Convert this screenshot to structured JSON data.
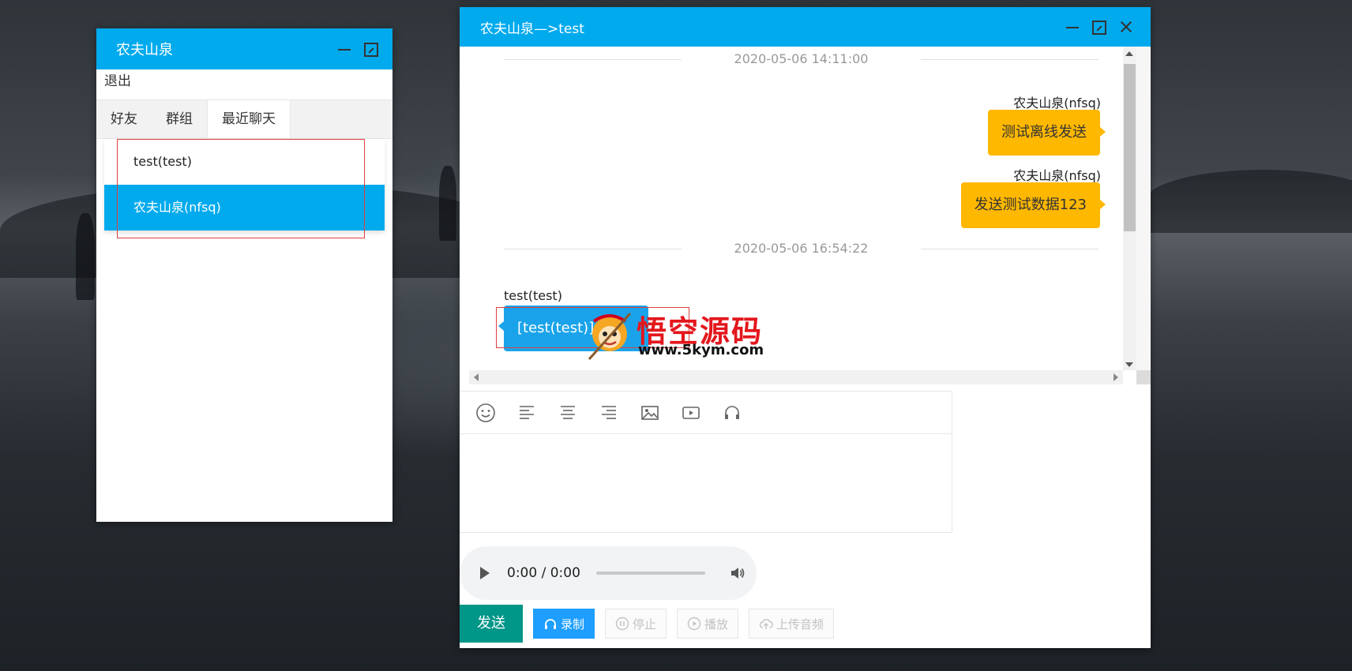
{
  "left_window": {
    "title": "农夫山泉",
    "logout": "退出",
    "tabs": [
      "好友",
      "群组",
      "最近聊天"
    ],
    "active_tab": "最近聊天",
    "contacts": [
      {
        "label": "test(test)"
      },
      {
        "label": "农夫山泉(nfsq)"
      }
    ],
    "active_contact": "农夫山泉(nfsq)"
  },
  "chat_window": {
    "title": "农夫山泉—>test",
    "timestamps": [
      "2020-05-06 14:11:00",
      "2020-05-06 16:54:22"
    ],
    "messages": [
      {
        "sender": "农夫山泉(nfsq)",
        "text": "测试离线发送",
        "side": "right"
      },
      {
        "sender": "农夫山泉(nfsq)",
        "text": "发送测试数据123",
        "side": "right"
      },
      {
        "sender": "test(test)",
        "text": "[test(test)]",
        "side": "left"
      }
    ],
    "toolbar_icons": [
      "emoji-icon",
      "align-left-icon",
      "align-center-icon",
      "align-right-icon",
      "image-icon",
      "video-icon",
      "audio-icon"
    ],
    "audio_player": {
      "time": "0:00 / 0:00"
    },
    "buttons": {
      "send": "发送",
      "record": "录制",
      "stop": "停止",
      "play": "播放",
      "upload": "上传音频"
    }
  },
  "watermark": {
    "title": "悟空源码",
    "url": "www.5kym.com"
  },
  "colors": {
    "title_bar": "#01aaed",
    "my_bubble": "#ffb800",
    "other_bubble": "#1aa3ea",
    "send_button": "#009688",
    "record_button": "#1e9fff"
  }
}
